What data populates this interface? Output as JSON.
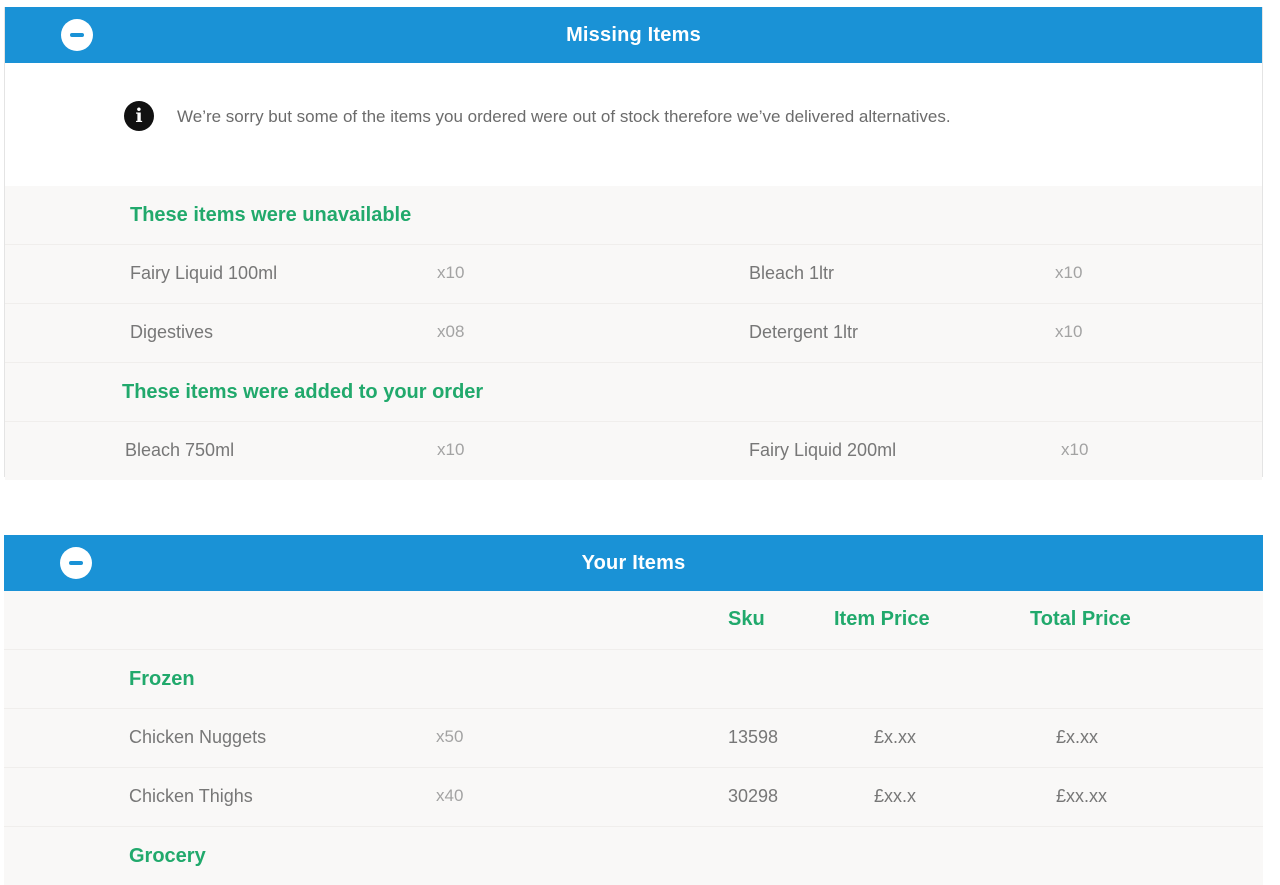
{
  "missing_panel": {
    "title": "Missing Items",
    "notice": "We’re sorry but some of the items you ordered were out of stock therefore we’ve delivered alternatives.",
    "unavailable_heading": "These items were unavailable",
    "unavailable": [
      {
        "name": "Fairy Liquid 100ml",
        "qty": "x10",
        "name2": "Bleach 1ltr",
        "qty2": "x10"
      },
      {
        "name": "Digestives",
        "qty": "x08",
        "name2": "Detergent 1ltr",
        "qty2": "x10"
      }
    ],
    "added_heading": "These items were added to your order",
    "added": [
      {
        "name": "Bleach 750ml",
        "qty": "x10",
        "name2": "Fairy Liquid 200ml",
        "qty2": "x10"
      }
    ]
  },
  "items_panel": {
    "title": "Your Items",
    "columns": {
      "sku": "Sku",
      "item_price": "Item Price",
      "total_price": "Total Price"
    },
    "categories": [
      {
        "name": "Frozen",
        "items": [
          {
            "name": "Chicken Nuggets",
            "qty": "x50",
            "sku": "13598",
            "item_price": "£x.xx",
            "total_price": "£x.xx"
          },
          {
            "name": "Chicken Thighs",
            "qty": "x40",
            "sku": "30298",
            "item_price": "£xx.x",
            "total_price": "£xx.xx"
          }
        ]
      },
      {
        "name": "Grocery",
        "items": []
      }
    ]
  },
  "colors": {
    "header_blue": "#1a92d6",
    "accent_green": "#21a96c"
  },
  "icons": {
    "collapse": "minus-circle-icon",
    "info": "info-circle-icon"
  }
}
